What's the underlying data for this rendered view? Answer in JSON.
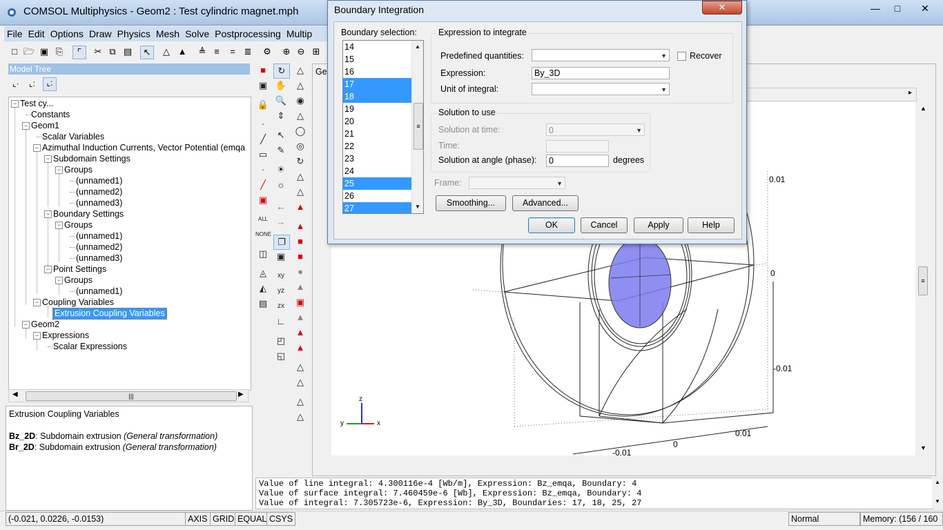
{
  "window": {
    "title": "COMSOL Multiphysics - Geom2 : Test cylindric magnet.mph",
    "icon": "comsol-app-icon"
  },
  "menubar": [
    "File",
    "Edit",
    "Options",
    "Draw",
    "Physics",
    "Mesh",
    "Solve",
    "Postprocessing",
    "Multip"
  ],
  "model_tree": {
    "header": "Model Tree",
    "nodes": {
      "root": "Test cy...",
      "constants": "Constants",
      "geom1": "Geom1",
      "scalar_variables": "Scalar Variables",
      "app_mode": "Azimuthal Induction Currents, Vector Potential (emqa",
      "subdomain_settings": "Subdomain Settings",
      "groups": "Groups",
      "unnamed1": "(unnamed1)",
      "unnamed2": "(unnamed2)",
      "unnamed3": "(unnamed3)",
      "boundary_settings": "Boundary Settings",
      "point_settings": "Point Settings",
      "coupling_variables": "Coupling Variables",
      "extrusion_coupling": "Extrusion Coupling Variables",
      "geom2": "Geom2",
      "expressions": "Expressions",
      "scalar_expressions": "Scalar Expressions"
    }
  },
  "info_panel": {
    "title": "Extrusion Coupling Variables",
    "rows": [
      {
        "name": "Bz_2D",
        "desc": ": Subdomain extrusion ",
        "type": "(General transformation)"
      },
      {
        "name": "Br_2D",
        "desc": ": Subdomain extrusion ",
        "type": "(General transformation)"
      }
    ]
  },
  "graphics": {
    "tab_label": "Ge",
    "axis_labels": {
      "z": "z",
      "y": "y",
      "x": "x"
    },
    "tick_labels": {
      "right_top": "0.01",
      "right_mid": "0",
      "right_bottom": "-0.01",
      "bottom_right": "0.01",
      "bottom_mid": "0",
      "bottom_left": "-0.01"
    }
  },
  "log": [
    "Value of line integral: 4.300116e-4 [Wb/m], Expression: Bz_emqa, Boundary: 4",
    "Value of surface integral: 7.460459e-6 [Wb], Expression: Bz_emqa, Boundary: 4",
    "Value of integral: 7.305723e-6, Expression: By_3D, Boundaries: 17, 18, 25, 27"
  ],
  "statusbar": {
    "coords": "(-0.021, 0.0226, -0.0153)",
    "toggles": [
      "AXIS",
      "GRID",
      "EQUAL",
      "CSYS"
    ],
    "mode": "Normal",
    "memory": "Memory: (156 / 160"
  },
  "dialog": {
    "title": "Boundary Integration",
    "close_label": "✕",
    "boundary_selection_label": "Boundary selection:",
    "boundaries": [
      {
        "id": "14",
        "selected": false
      },
      {
        "id": "15",
        "selected": false
      },
      {
        "id": "16",
        "selected": false
      },
      {
        "id": "17",
        "selected": true
      },
      {
        "id": "18",
        "selected": true
      },
      {
        "id": "19",
        "selected": false
      },
      {
        "id": "20",
        "selected": false
      },
      {
        "id": "21",
        "selected": false
      },
      {
        "id": "22",
        "selected": false
      },
      {
        "id": "23",
        "selected": false
      },
      {
        "id": "24",
        "selected": false
      },
      {
        "id": "25",
        "selected": true
      },
      {
        "id": "26",
        "selected": false
      },
      {
        "id": "27",
        "selected": true
      }
    ],
    "expression_group_label": "Expression to integrate",
    "predefined_label": "Predefined quantities:",
    "predefined_value": "",
    "recover_label": "Recover",
    "recover_checked": false,
    "expression_label": "Expression:",
    "expression_value": "By_3D",
    "unit_label": "Unit of integral:",
    "unit_value": "",
    "solution_group_label": "Solution to use",
    "solution_time_label": "Solution at time:",
    "solution_time_value": "0",
    "time_label": "Time:",
    "time_value": "",
    "angle_label": "Solution at angle (phase):",
    "angle_value": "0",
    "angle_unit": "degrees",
    "frame_label": "Frame:",
    "frame_value": "",
    "smoothing_label": "Smoothing...",
    "advanced_label": "Advanced...",
    "ok_label": "OK",
    "cancel_label": "Cancel",
    "apply_label": "Apply",
    "help_label": "Help"
  }
}
